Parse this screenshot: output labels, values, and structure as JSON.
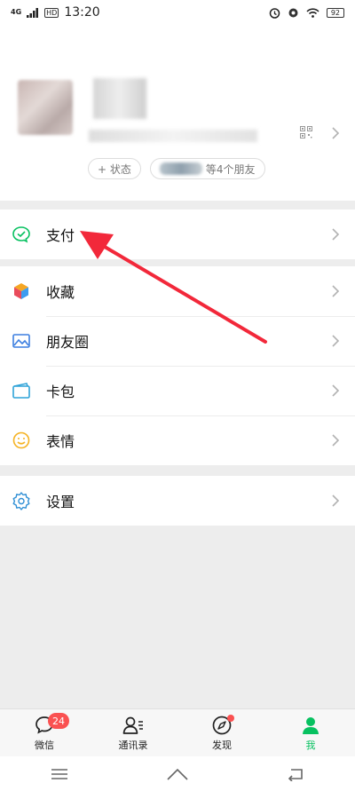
{
  "status_bar": {
    "network": "4G",
    "hd": "HD",
    "time": "13:20",
    "battery": "92"
  },
  "profile": {
    "status_chip": "+ 状态",
    "friends_chip_suffix": "等4个朋友"
  },
  "menu": {
    "pay": "支付",
    "favorites": "收藏",
    "moments": "朋友圈",
    "cards": "卡包",
    "stickers": "表情",
    "settings": "设置"
  },
  "bottom_nav": {
    "chats": "微信",
    "chats_badge": "24",
    "contacts": "通讯录",
    "discover": "发现",
    "me": "我"
  },
  "colors": {
    "accent": "#07c160",
    "badge": "#fa5151",
    "arrow": "#f2283a"
  }
}
